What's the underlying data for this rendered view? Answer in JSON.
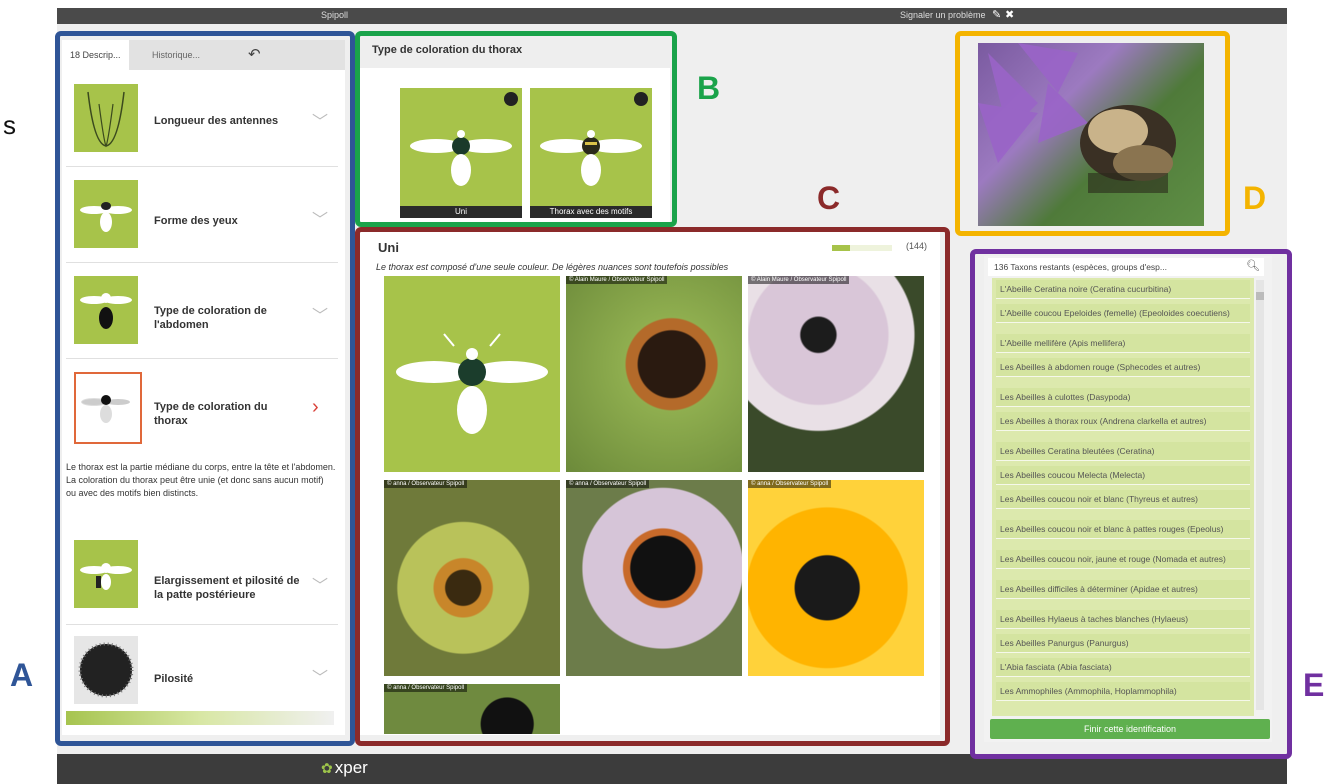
{
  "topbar": {
    "title": "Spipoll",
    "report_label": "Signaler un problème",
    "wrench_icon": "✎",
    "close_icon": "✖"
  },
  "margin_text": "s",
  "panel_a": {
    "tabs": [
      "18 Descrip...",
      "Historique..."
    ],
    "descriptors": [
      {
        "label": "Longueur des antennes"
      },
      {
        "label": "Forme des yeux"
      },
      {
        "label": "Type de coloration de l'abdomen"
      },
      {
        "label": "Type de coloration du thorax"
      },
      {
        "label": "Elargissement et pilosité de la patte postérieure"
      },
      {
        "label": "Pilosité"
      }
    ],
    "active_description": "Le thorax est la partie médiane du corps, entre la tête et l'abdomen.\nLa coloration du thorax peut être unie (et donc sans aucun motif) ou avec des motifs bien distincts."
  },
  "panel_b": {
    "title": "Type de coloration du thorax",
    "states": [
      "Uni",
      "Thorax avec des motifs"
    ]
  },
  "panel_c": {
    "title": "Uni",
    "count": "(144)",
    "progress": 0.3,
    "description": "Le thorax est composé d'une seule couleur. De légères nuances sont toutefois possibles",
    "photo_captions": [
      "",
      "© Alain Maure / Observateur Spipoll",
      "© Alain Maure / Observateur Spipoll",
      "© anna / Observateur Spipoll",
      "© anna / Observateur Spipoll",
      "© anna / Observateur Spipoll",
      "© anna / Observateur Spipoll"
    ]
  },
  "panel_e": {
    "header": "136 Taxons restants (espèces, groups d'esp...",
    "taxa": [
      "L'Abeille Ceratina noire (Ceratina cucurbitina)",
      "L'Abeille coucou Epeloides (femelle) (Epeoloides coecutiens)",
      "L'Abeille mellifère (Apis mellifera)",
      "Les Abeilles à abdomen rouge (Sphecodes et autres)",
      "Les Abeilles à culottes (Dasypoda)",
      "Les Abeilles à thorax roux (Andrena clarkella et autres)",
      "Les Abeilles Ceratina bleutées (Ceratina)",
      "Les Abeilles coucou Melecta (Melecta)",
      "Les Abeilles coucou noir et blanc (Thyreus et autres)",
      "Les Abeilles coucou noir et blanc à pattes rouges (Epeolus)",
      "Les Abeilles coucou noir, jaune et rouge (Nomada et autres)",
      "Les Abeilles difficiles à déterminer (Apidae et autres)",
      "Les Abeilles Hylaeus à taches blanches (Hylaeus)",
      "Les Abeilles Panurgus (Panurgus)",
      "L'Abia fasciata (Abia fasciata)",
      "Les Ammophiles (Ammophila, Hoplammophila)"
    ],
    "finish_label": "Finir cette identification"
  },
  "footer": {
    "logo_text": "xper"
  },
  "annotations": {
    "A": {
      "letter": "A",
      "color": "#2f5597"
    },
    "B": {
      "letter": "B",
      "color": "#1aa34a"
    },
    "C": {
      "letter": "C",
      "color": "#8b2a2a"
    },
    "D": {
      "letter": "D",
      "color": "#f4b400"
    },
    "E": {
      "letter": "E",
      "color": "#7030a0"
    }
  }
}
